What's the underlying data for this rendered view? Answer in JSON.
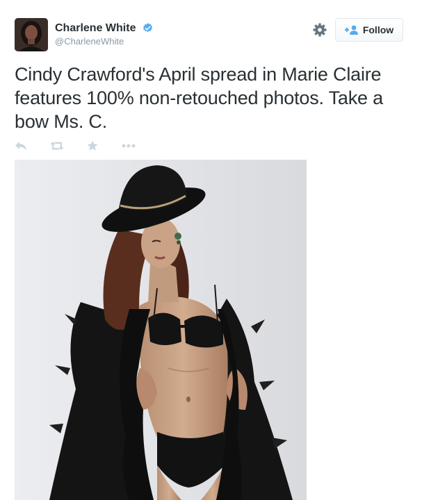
{
  "user": {
    "display_name": "Charlene White",
    "handle": "@CharleneWhite",
    "verified": true
  },
  "follow_button": {
    "label": "Follow"
  },
  "tweet": {
    "text": "Cindy Crawford's April spread in Marie Claire features 100% non-retouched photos. Take a bow Ms. C."
  },
  "actions": [
    "reply-icon",
    "retweet-icon",
    "favorite-icon",
    "more-icon"
  ],
  "icons": {
    "settings": "gear-icon",
    "verified": "verified-badge-icon",
    "follow": "add-user-icon"
  },
  "colors": {
    "text": "#292f33",
    "muted": "#8899a6",
    "action_gray": "#ccd6dd",
    "brand_blue": "#55acee",
    "gear": "#66757f",
    "photo_background": "#e2e3e6"
  }
}
